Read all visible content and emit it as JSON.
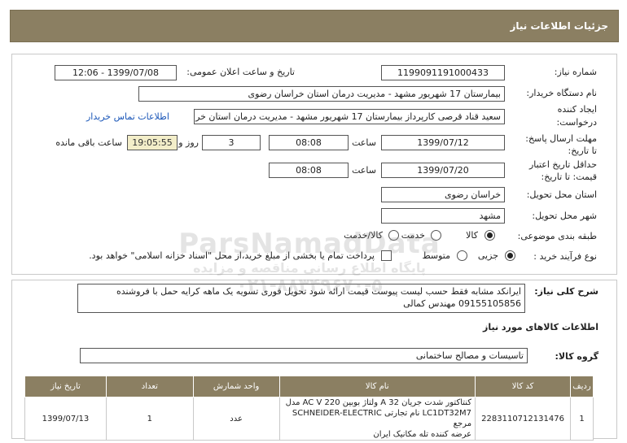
{
  "header": {
    "title": "جزئیات اطلاعات نیاز"
  },
  "fields": {
    "need_number_label": "شماره نیاز:",
    "need_number": "1199091191000433",
    "announce_label": "تاریخ و ساعت اعلان عمومی:",
    "announce_value": "1399/07/08 - 12:06",
    "buyer_label": "نام دستگاه خریدار:",
    "buyer_value": "بیمارستان 17 شهریور مشهد - مدیریت درمان استان خراسان رضوی",
    "creator_label_1": "ایجاد کننده",
    "creator_label_2": "درخواست:",
    "creator_value": "سعید قناد قرصی کارپرداز بیمارستان 17 شهریور مشهد - مدیریت درمان استان خراسان رضوی",
    "contact_link": "اطلاعات تماس خریدار",
    "deadline_label_1": "مهلت ارسال پاسخ:",
    "deadline_label_2": "تا تاریخ:",
    "deadline_date": "1399/07/12",
    "time_label": "ساعت",
    "deadline_time": "08:08",
    "days_value": "3",
    "days_label": "روز و",
    "remaining_time": "19:05:55",
    "remaining_label": "ساعت باقی مانده",
    "validity_label_1": "حداقل تاریخ اعتبار",
    "validity_label_2": "قیمت: تا تاریخ:",
    "validity_date": "1399/07/20",
    "validity_time": "08:08",
    "province_label": "استان محل تحویل:",
    "province_value": "خراسان رضوی",
    "city_label": "شهر محل تحویل:",
    "city_value": "مشهد",
    "category_label": "طبقه بندی موضوعی:",
    "category_options": [
      "کالا",
      "خدمت",
      "کالا/خدمت"
    ],
    "process_label": "نوع فرآیند خرید :",
    "process_options": [
      "جزیی",
      "متوسط"
    ],
    "payment_note": "پرداخت تمام یا بخشی از مبلغ خرید،از محل \"اسناد خزانه اسلامی\" خواهد بود."
  },
  "description": {
    "label": "شرح کلی نیاز:",
    "line1": "ایرانکد مشابه فقط حسب لیست پیوست قیمت ارائه شود تحویل فوری تسویه یک ماهه کرایه حمل با فروشنده",
    "line2": "09155105856 مهندس کمالی"
  },
  "goods": {
    "section_title": "اطلاعات کالاهای مورد نیاز",
    "group_label": "گروه کالا:",
    "group_value": "تاسیسات و مصالح ساختمانی"
  },
  "table": {
    "headers": [
      "ردیف",
      "کد کالا",
      "نام کالا",
      "واحد شمارش",
      "تعداد",
      "تاریخ نیاز"
    ],
    "rows": [
      {
        "row": "1",
        "code": "2283110712131476",
        "name_1": "کنتاکتور شدت جریان A 32 ولتاژ بوبین AC V 220 مدل",
        "name_2": "LC1DT32M7 نام تجارتی SCHNEIDER-ELECTRIC مرجع",
        "name_3": "عرضه کننده تله مکانیک ایران",
        "unit": "عدد",
        "qty": "1",
        "date": "1399/07/13"
      }
    ]
  },
  "watermark": {
    "line1": "ParsNamadData",
    "line2": "پایگاه اطلاع رسانی مناقصه و مزایده",
    "line3": "۰۲۱-۸۸۳۴۹۶۷۰-۵"
  },
  "colors": {
    "header_bg": "#8b7f62",
    "link": "#1a56b8",
    "timer_bg": "#f3eec9"
  }
}
